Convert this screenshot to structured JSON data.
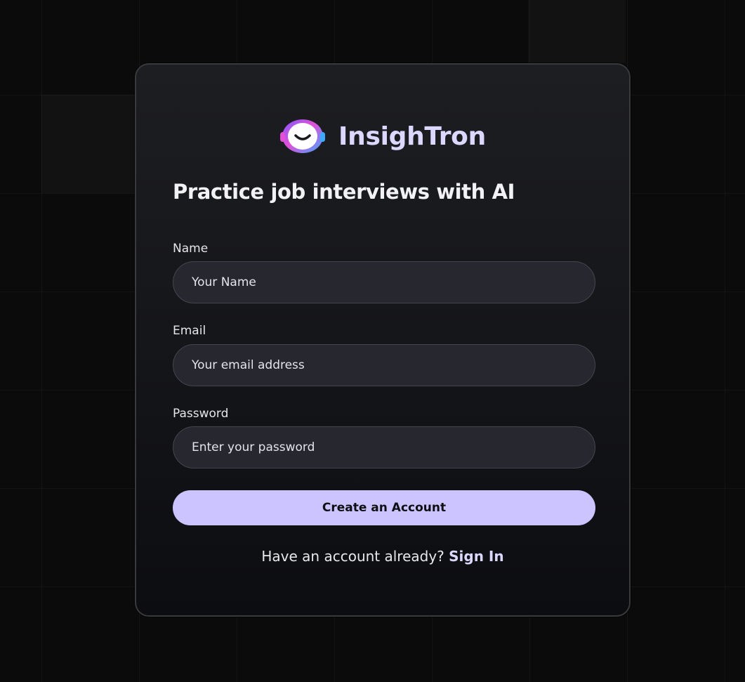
{
  "brand": {
    "name": "InsighTron",
    "logo_icon": "robot-face-logo-icon",
    "brand_color": "#dcd7ff"
  },
  "headline": "Practice job interviews with AI",
  "form": {
    "name": {
      "label": "Name",
      "placeholder": "Your Name"
    },
    "email": {
      "label": "Email",
      "placeholder": "Your email address"
    },
    "password": {
      "label": "Password",
      "placeholder": "Enter your password"
    },
    "submit_label": "Create an Account"
  },
  "footer": {
    "prompt": "Have an account already?",
    "link_label": "Sign In"
  },
  "colors": {
    "background": "#0b0b0b",
    "card": "#1a1b1f",
    "input": "#26272f",
    "accent_button": "#cbc4ff"
  }
}
